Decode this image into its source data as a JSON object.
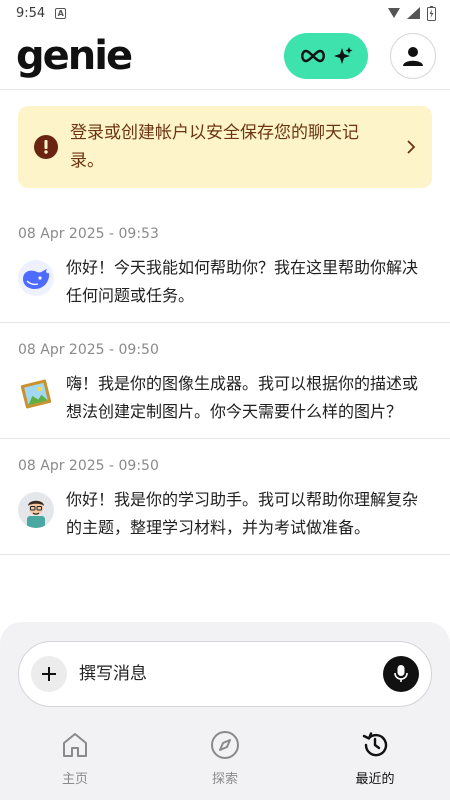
{
  "status_bar": {
    "time": "9:54",
    "notification_glyph": "A"
  },
  "header": {
    "logo": "genie",
    "premium_icon": "infinity-sparkle-icon",
    "profile_icon": "person-icon",
    "accent": "#3ee2ac"
  },
  "banner": {
    "text": "登录或创建帐户以安全保存您的聊天记录。",
    "bg": "#fdf4c9"
  },
  "conversations": [
    {
      "time": "08 Apr 2025 - 09:53",
      "avatar": "whale-icon",
      "text": "你好！今天我能如何帮助你？我在这里帮助你解决任何问题或任务。"
    },
    {
      "time": "08 Apr 2025 - 09:50",
      "avatar": "picture-frame-icon",
      "text": "嗨！我是你的图像生成器。我可以根据你的描述或想法创建定制图片。你今天需要什么样的图片？"
    },
    {
      "time": "08 Apr 2025 - 09:50",
      "avatar": "tutor-avatar-icon",
      "text": "你好！我是你的学习助手。我可以帮助你理解复杂的主题，整理学习材料，并为考试做准备。"
    }
  ],
  "composer": {
    "placeholder": "撰写消息"
  },
  "nav": [
    {
      "label": "主页",
      "icon": "home-icon",
      "active": false
    },
    {
      "label": "探索",
      "icon": "compass-icon",
      "active": false
    },
    {
      "label": "最近的",
      "icon": "history-icon",
      "active": true
    }
  ]
}
